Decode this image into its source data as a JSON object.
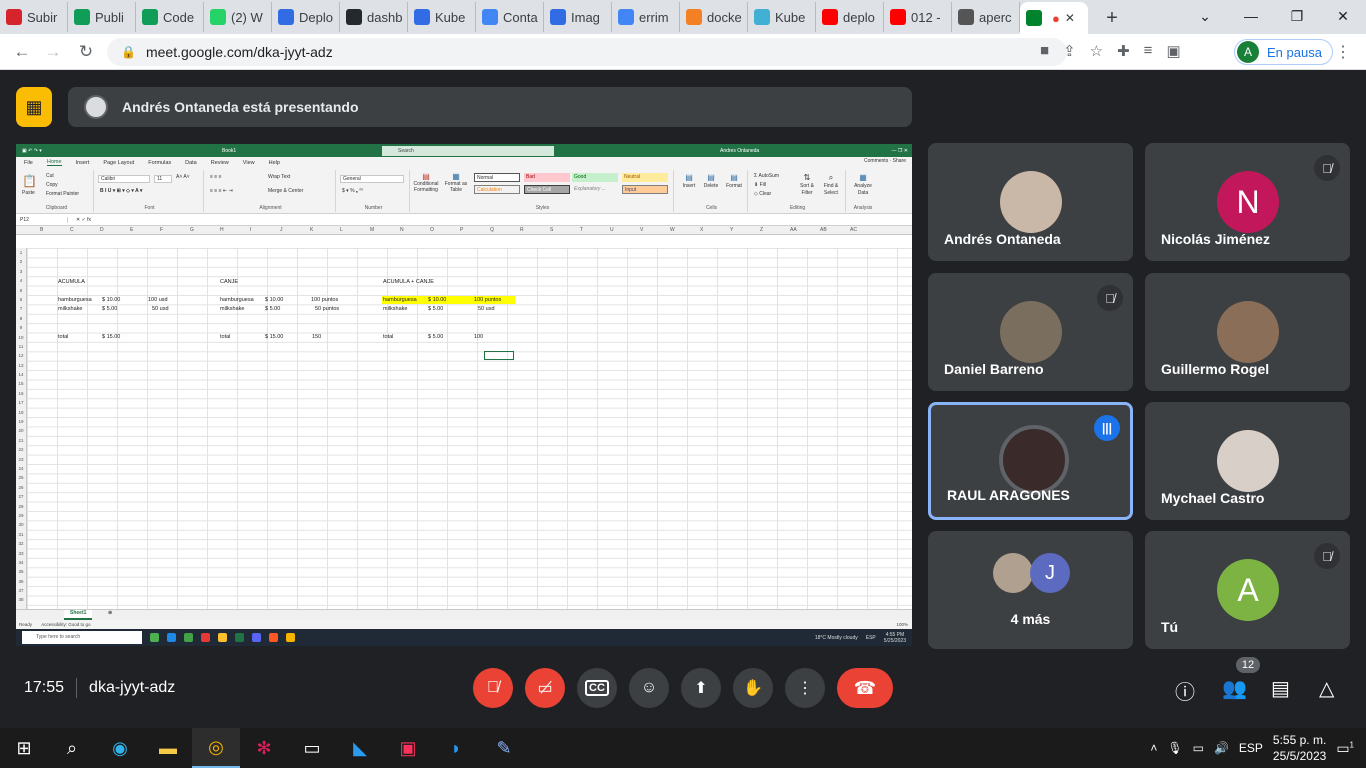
{
  "browser": {
    "tabs": [
      {
        "title": "Subir",
        "favicon": "kfc-icon",
        "color": "#d6242c"
      },
      {
        "title": "Publi",
        "favicon": "sheets-icon",
        "color": "#0f9d58"
      },
      {
        "title": "Code",
        "favicon": "sheets-icon",
        "color": "#0f9d58"
      },
      {
        "title": "(2) W",
        "favicon": "whatsapp-icon",
        "color": "#25d366"
      },
      {
        "title": "Deplo",
        "favicon": "kubernetes-icon",
        "color": "#326ce5"
      },
      {
        "title": "dashb",
        "favicon": "github-icon",
        "color": "#24292e"
      },
      {
        "title": "Kube",
        "favicon": "kubernetes-icon",
        "color": "#326ce5"
      },
      {
        "title": "Conta",
        "favicon": "google-icon",
        "color": "#4285f4"
      },
      {
        "title": "Imag",
        "favicon": "kubernetes-icon",
        "color": "#326ce5"
      },
      {
        "title": "errim",
        "favicon": "google-icon",
        "color": "#4285f4"
      },
      {
        "title": "docke",
        "favicon": "stackoverflow-icon",
        "color": "#f48024"
      },
      {
        "title": "Kube",
        "favicon": "kube-icon",
        "color": "#42b0d5"
      },
      {
        "title": "deplo",
        "favicon": "youtube-icon",
        "color": "#ff0000"
      },
      {
        "title": "012 -",
        "favicon": "youtube-icon",
        "color": "#ff0000"
      },
      {
        "title": "aperc",
        "favicon": "x-icon",
        "color": "#555555"
      },
      {
        "title": "",
        "favicon": "meet-icon",
        "color": "#00832d"
      }
    ],
    "url": "meet.google.com/dka-jyyt-adz",
    "profile_status": "En pausa",
    "profile_initial": "A"
  },
  "presentation": {
    "banner": "Andrés Ontaneda está presentando"
  },
  "excel": {
    "title": "Book1",
    "search": "Search",
    "user": "Andres Ontaneda",
    "menu": [
      "File",
      "Home",
      "Insert",
      "Page Layout",
      "Formulas",
      "Data",
      "Review",
      "View",
      "Help"
    ],
    "comments": "Comments",
    "share": "Share",
    "ribbon": {
      "clipboard": "Clipboard",
      "cut": "Cut",
      "copy": "Copy",
      "painter": "Format Painter",
      "paste": "Paste",
      "font": "Font",
      "font_name": "Calibri",
      "font_size": "11",
      "alignment": "Alignment",
      "wrap": "Wrap Text",
      "merge": "Merge & Center",
      "number": "Number",
      "number_format": "General",
      "cond_fmt": "Conditional Formatting",
      "fmt_table": "Format as Table",
      "styles": "Styles",
      "style_names": [
        "Normal",
        "Bad",
        "Good",
        "Neutral",
        "Calculation",
        "Check Cell",
        "Explanatory ...",
        "Input"
      ],
      "cells": "Cells",
      "insert": "Insert",
      "delete": "Delete",
      "format": "Format",
      "editing": "Editing",
      "autosum": "AutoSum",
      "fill": "Fill",
      "clear": "Clear",
      "sort": "Sort & Filter",
      "find": "Find & Select",
      "analysis": "Analysis",
      "analyze": "Analyze Data"
    },
    "namebox": "P12",
    "columns": [
      "B",
      "C",
      "D",
      "E",
      "F",
      "G",
      "H",
      "I",
      "J",
      "K",
      "L",
      "M",
      "N",
      "O",
      "P",
      "Q",
      "R",
      "S",
      "T",
      "U",
      "V",
      "W",
      "X",
      "Y",
      "Z",
      "AA",
      "AB",
      "AC"
    ],
    "rows": [
      "1",
      "2",
      "3",
      "4",
      "5",
      "6",
      "7",
      "8",
      "9",
      "10",
      "11",
      "12",
      "13",
      "14",
      "15",
      "16",
      "17",
      "18",
      "19",
      "20",
      "21",
      "22",
      "23",
      "24",
      "25",
      "26",
      "27",
      "28",
      "29",
      "30",
      "31",
      "32",
      "33",
      "34",
      "35",
      "36",
      "37",
      "38"
    ],
    "cells": {
      "acumula": "ACUMULA",
      "canje": "CANJE",
      "acumula_canje": "ACUMULA + CANJE",
      "a_item1": "hamburguesa",
      "a_d1": "$  10.00",
      "a_e1": "100 usd",
      "a_item2": "milkshake",
      "a_d2": "$    5.00",
      "a_e2": "50 usd",
      "a_total": "total",
      "a_total_val": "$  15.00",
      "c_item1": "hamburguesa",
      "c_d1": "$  10.00",
      "c_e1": "100 puntos",
      "c_item2": "milkshake",
      "c_d2": "$    5.00",
      "c_e2": "50 puntos",
      "c_total": "total",
      "c_total_val": "$  15.00",
      "c_total_pts": "150",
      "m_item1": "hamburguesa",
      "m_d1": "$  10.00",
      "m_e1": "100 puntos",
      "m_item2": "milkshake",
      "m_d2": "$    5.00",
      "m_e2": "50 usd",
      "m_total": "total",
      "m_total_val": "$    5.00",
      "m_total_pts": "100"
    },
    "sheet": "Sheet1",
    "status_ready": "Ready",
    "status_access": "Accessibility: Good to go",
    "zoom": "100%",
    "taskbar_search": "Type here to search",
    "weather": "18°C  Mostly cloudy",
    "lang": "ESP",
    "time": "4:55 PM",
    "date": "5/25/2023"
  },
  "participants": [
    {
      "name": "Andrés Ontaneda",
      "muted": false,
      "speaking": false,
      "avatar_color": "#c9b8a8",
      "initial": ""
    },
    {
      "name": "Nicolás Jiménez",
      "muted": true,
      "speaking": false,
      "avatar_color": "#c2185b",
      "initial": "N"
    },
    {
      "name": "Daniel Barreno",
      "muted": true,
      "speaking": false,
      "avatar_color": "#7a6e5e",
      "initial": ""
    },
    {
      "name": "Guillermo Rogel",
      "muted": false,
      "speaking": false,
      "avatar_color": "#8a6e58",
      "initial": ""
    },
    {
      "name": "RAUL ARAGONES",
      "muted": false,
      "speaking": true,
      "avatar_color": "#3a2a2a",
      "initial": ""
    },
    {
      "name": "Mychael Castro",
      "muted": false,
      "speaking": false,
      "avatar_color": "#d8d0c8",
      "initial": ""
    },
    {
      "name": "4 más",
      "muted": false,
      "speaking": false,
      "avatar_color": "#5c6bc0",
      "initial": "J"
    },
    {
      "name": "Tú",
      "muted": true,
      "speaking": false,
      "avatar_color": "#7cb342",
      "initial": "A"
    }
  ],
  "meeting": {
    "time": "17:55",
    "code": "dka-jyyt-adz",
    "participant_count": "12"
  },
  "taskbar": {
    "lang": "ESP",
    "time": "5:55 p. m.",
    "date": "25/5/2023",
    "notifications": "1"
  }
}
